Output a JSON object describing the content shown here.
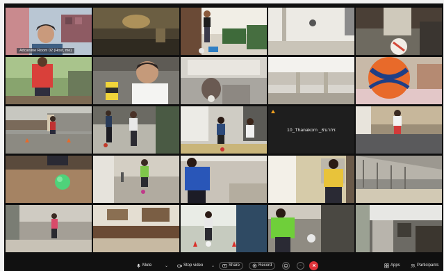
{
  "meeting": {
    "tiles": [
      {
        "name_tag": "Adcanline Room 02 (Host, me)",
        "tag_style": "bottom"
      },
      {},
      {},
      {},
      {},
      {},
      {},
      {},
      {},
      {},
      {},
      {},
      {},
      {
        "name_tag": "10_Thanakorn _ธนากร",
        "tag_style": "center",
        "warning": true
      },
      {},
      {},
      {},
      {},
      {},
      {},
      {},
      {},
      {},
      {},
      {}
    ]
  },
  "toolbar": {
    "mute_label": "Mute",
    "stop_video_label": "Stop video",
    "share_label": "Share",
    "record_label": "Record",
    "apps_label": "Apps",
    "participants_label": "Participants",
    "more_label": "···",
    "chevron": "⌄"
  },
  "colors": {
    "window_bg": "#0f0f0f",
    "active_speaker_outline": "#9dc2f0",
    "end_button": "#e0333a",
    "toolbar_bg": "#111111"
  }
}
